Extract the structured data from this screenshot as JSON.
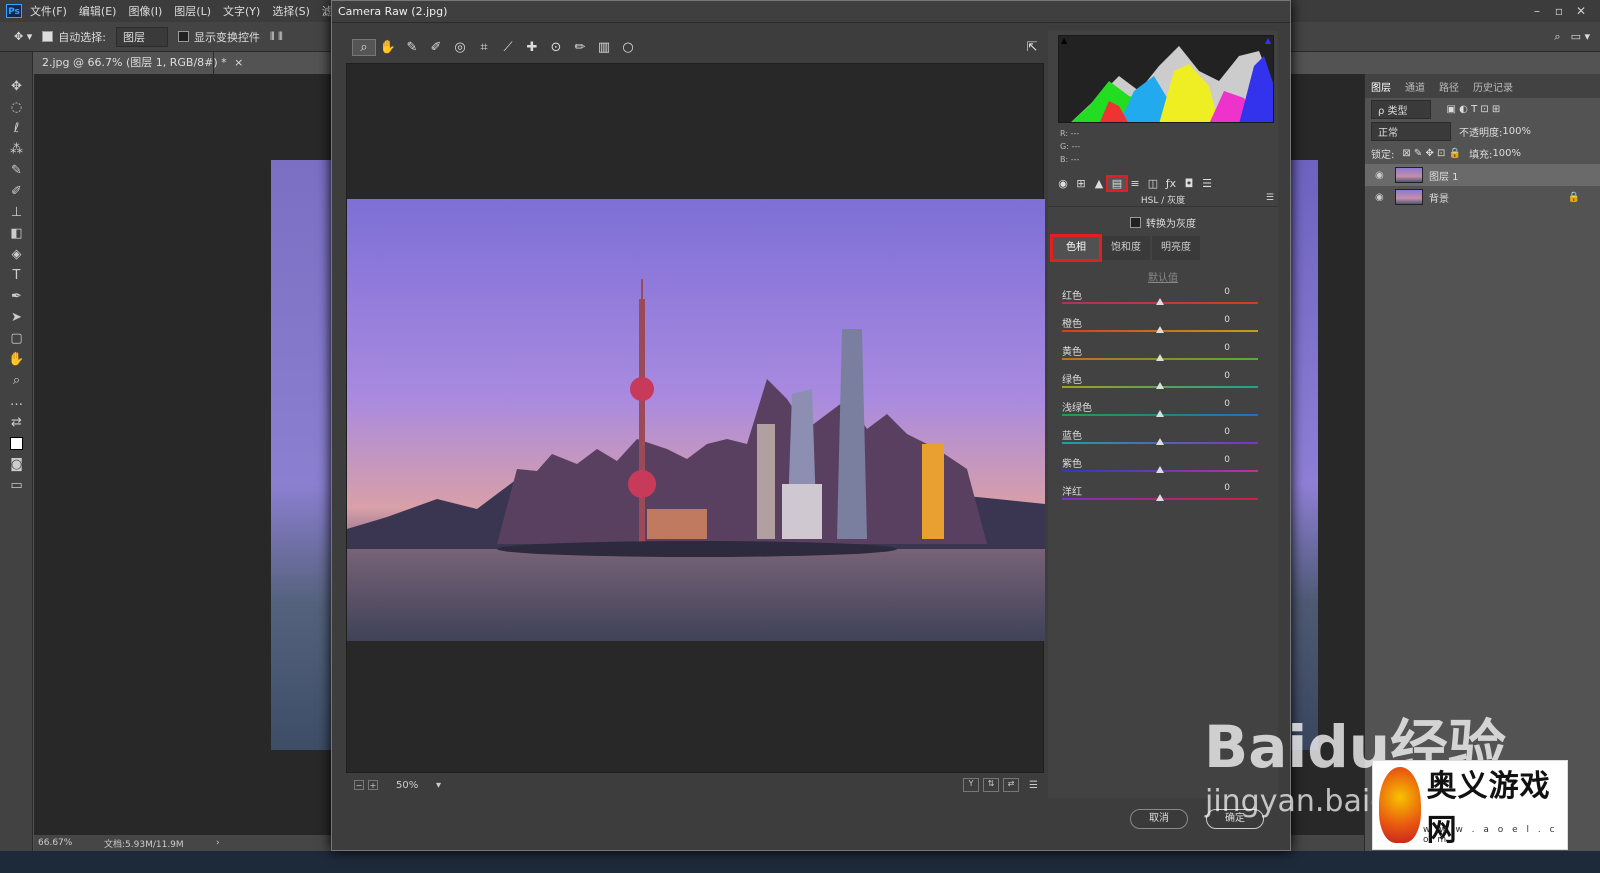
{
  "menubar": {
    "logo": "Ps",
    "items": [
      "文件(F)",
      "编辑(E)",
      "图像(I)",
      "图层(L)",
      "文字(Y)",
      "选择(S)",
      "滤镜(T)"
    ],
    "window_buttons": [
      "–",
      "▫",
      "✕"
    ]
  },
  "optionsbar": {
    "auto_select_label": "自动选择:",
    "auto_select_value": "图层",
    "show_transform_label": "显示变换控件"
  },
  "document_tab": {
    "title": "2.jpg @ 66.7% (图层 1, RGB/8#) *",
    "close": "×"
  },
  "statusbar": {
    "zoom": "66.67%",
    "doc_info": "文档:5.93M/11.9M",
    "arrow": "›"
  },
  "camera_raw": {
    "title": "Camera Raw (2.jpg)",
    "histogram_readout": [
      "R: ---",
      "G: ---",
      "B: ---"
    ],
    "panel_title": "HSL / 灰度",
    "convert_grayscale_label": "转换为灰度",
    "subtabs": [
      "色相",
      "饱和度",
      "明亮度"
    ],
    "active_subtab": "色相",
    "default_link": "默认值",
    "sliders": [
      {
        "label": "红色",
        "value": "0",
        "color_from": "#b03060",
        "color_to": "#d04020"
      },
      {
        "label": "橙色",
        "value": "0",
        "color_from": "#d04020",
        "color_to": "#c0a020"
      },
      {
        "label": "黄色",
        "value": "0",
        "color_from": "#c07020",
        "color_to": "#50b030"
      },
      {
        "label": "绿色",
        "value": "0",
        "color_from": "#a0a020",
        "color_to": "#20a090"
      },
      {
        "label": "浅绿色",
        "value": "0",
        "color_from": "#20a040",
        "color_to": "#2070c0"
      },
      {
        "label": "蓝色",
        "value": "0",
        "color_from": "#20a0a0",
        "color_to": "#8030c0"
      },
      {
        "label": "紫色",
        "value": "0",
        "color_from": "#2040c0",
        "color_to": "#c030a0"
      },
      {
        "label": "洋红",
        "value": "0",
        "color_from": "#8030c0",
        "color_to": "#d02040"
      }
    ],
    "zoom_value": "50%",
    "cancel_label": "取消",
    "ok_label": "确定"
  },
  "layers_panel": {
    "tabs": [
      "图层",
      "通道",
      "路径",
      "历史记录"
    ],
    "filter_label": "ρ 类型",
    "blend_mode": "正常",
    "opacity_label": "不透明度:",
    "opacity_value": "100%",
    "lock_label": "锁定:",
    "fill_label": "填充:",
    "fill_value": "100%",
    "layers": [
      {
        "name": "图层 1",
        "selected": true
      },
      {
        "name": "背景",
        "selected": false
      }
    ]
  },
  "watermarks": {
    "baidu": "Baidu经验",
    "baidu_url": "jingyan.baidu.com",
    "site_name": "奥义游戏网",
    "site_url": "w w w . a o e l . c o m"
  },
  "icons": {
    "cr_tools": [
      "zoom-icon",
      "hand-icon",
      "white-balance-icon",
      "color-sampler-icon",
      "target-adjust-icon",
      "crop-icon",
      "straighten-icon",
      "spot-removal-icon",
      "red-eye-icon",
      "adjustment-brush-icon",
      "graduated-filter-icon",
      "radial-filter-icon"
    ]
  }
}
